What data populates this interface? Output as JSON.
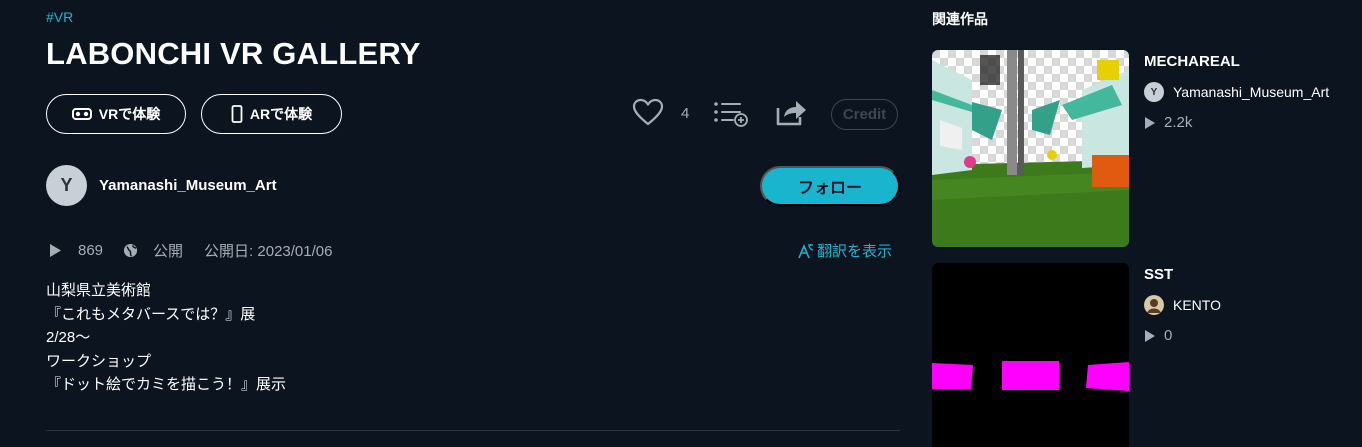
{
  "work": {
    "tag": "#VR",
    "title": "LABONCHI VR GALLERY",
    "vr_button": "VRで体験",
    "ar_button": "ARで体験",
    "likes": "4",
    "credit": "Credit",
    "author": {
      "avatar_letter": "Y",
      "name": "Yamanashi_Museum_Art"
    },
    "follow": "フォロー",
    "plays": "869",
    "visibility": "公開",
    "published": "公開日: 2023/01/06",
    "translate": "翻訳を表示",
    "description": [
      "山梨県立美術館",
      "『これもメタバースでは？』展",
      "2/28〜",
      "ワークショップ",
      "『ドット絵でカミを描こう！』展示"
    ]
  },
  "related": {
    "title": "関連作品",
    "items": [
      {
        "title": "MECHAREAL",
        "author": "Yamanashi_Museum_Art",
        "avatar_letter": "Y",
        "plays": "2.2k"
      },
      {
        "title": "SST",
        "author": "KENTO",
        "avatar_letter": "",
        "plays": "0"
      }
    ]
  },
  "colors": {
    "accent": "#19b5cf",
    "background": "#0c1420",
    "muted": "#a7adb5"
  },
  "icons": [
    "vr-goggles-icon",
    "phone-icon",
    "heart-icon",
    "playlist-add-icon",
    "share-icon",
    "play-icon",
    "globe-icon",
    "translate-icon"
  ]
}
